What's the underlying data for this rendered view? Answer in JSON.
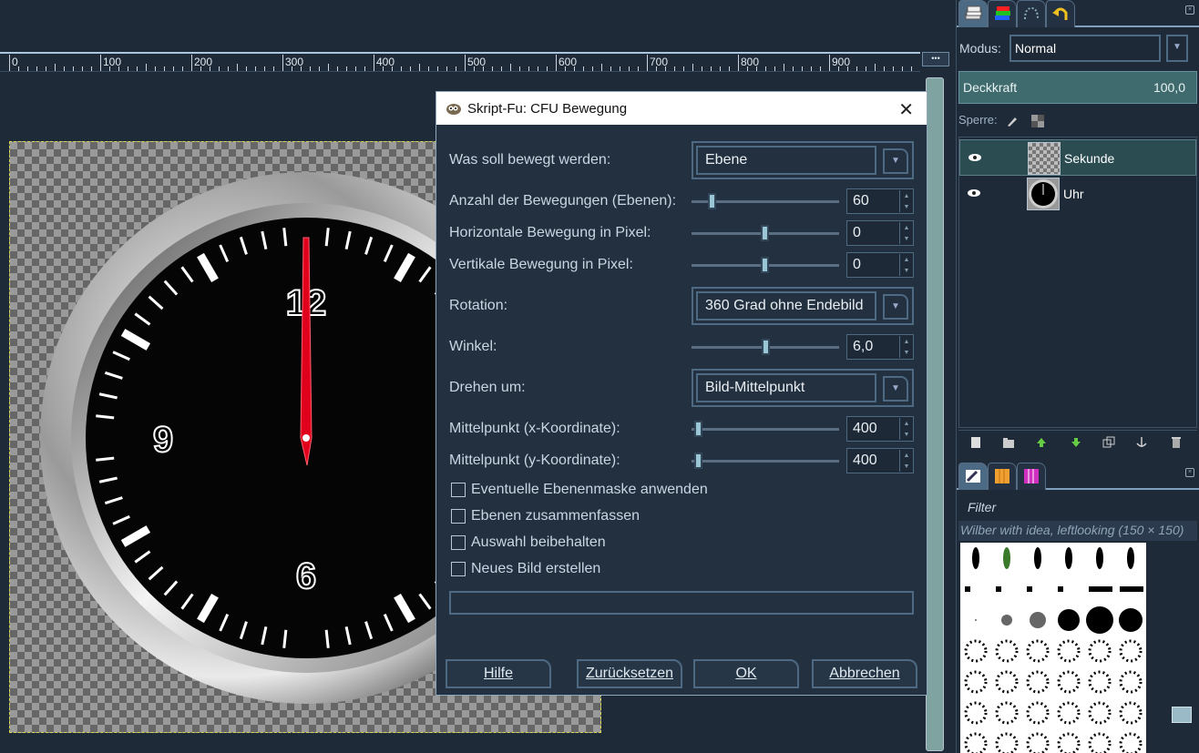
{
  "ruler": {
    "labels": [
      "0",
      "100",
      "200",
      "300",
      "400",
      "500",
      "600",
      "700",
      "800",
      "900"
    ]
  },
  "clock": {
    "numerals": [
      "12",
      "9",
      "6"
    ]
  },
  "dialog": {
    "title": "Skript-Fu: CFU Bewegung",
    "close_glyph": "✕",
    "fields": {
      "what_label": "Was soll bewegt werden:",
      "what_value": "Ebene",
      "count_label": "Anzahl der Bewegungen (Ebenen):",
      "count_value": "60",
      "horiz_label": "Horizontale Bewegung in Pixel:",
      "horiz_value": "0",
      "vert_label": "Vertikale Bewegung in Pixel:",
      "vert_value": "0",
      "rotation_label": "Rotation:",
      "rotation_value": "360 Grad ohne Endebild",
      "angle_label": "Winkel:",
      "angle_value": "6,0",
      "pivot_label": "Drehen um:",
      "pivot_value": "Bild-Mittelpunkt",
      "cx_label": "Mittelpunkt (x-Koordinate):",
      "cx_value": "400",
      "cy_label": "Mittelpunkt (y-Koordinate):",
      "cy_value": "400"
    },
    "checkboxes": [
      "Eventuelle Ebenenmaske anwenden",
      "Ebenen zusammenfassen",
      "Auswahl beibehalten",
      "Neues Bild erstellen"
    ],
    "buttons": {
      "help": "Hilfe",
      "reset": "Zurücksetzen",
      "ok": "OK",
      "cancel": "Abbrechen"
    }
  },
  "panel": {
    "mode_label": "Modus:",
    "mode_value": "Normal",
    "opacity_label": "Deckkraft",
    "opacity_value": "100,0",
    "lock_label": "Sperre:",
    "layers": [
      "Sekunde",
      "Uhr"
    ],
    "filter_label": "Filter",
    "brush_name": "Wilber with idea, leftlooking (150 × 150)"
  },
  "colors": {
    "bg": "#1f2a38",
    "accent": "#7f9fbc",
    "selected_layer": "#2b4d52",
    "hand": "#e0001b"
  }
}
